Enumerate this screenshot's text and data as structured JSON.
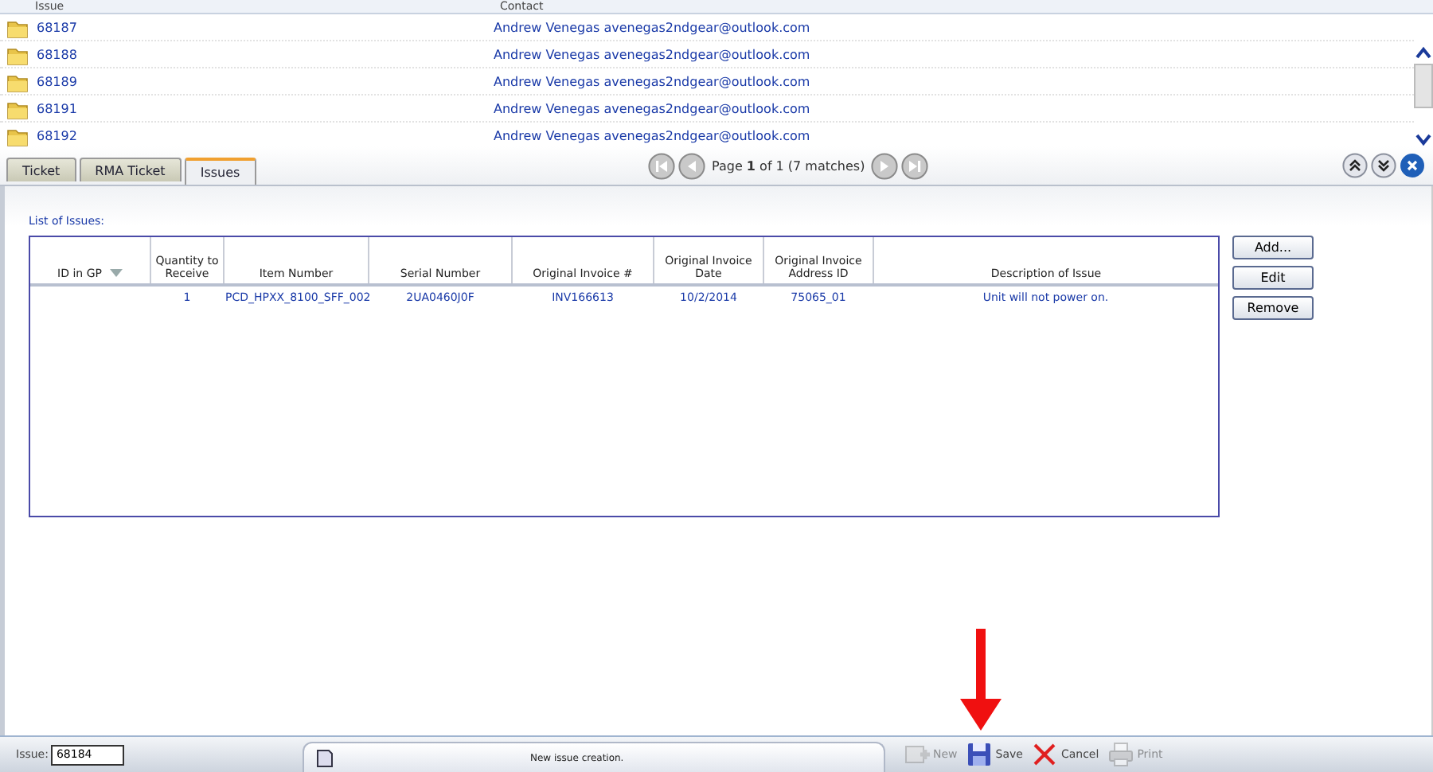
{
  "issue_list": {
    "columns": [
      "Issue",
      "Contact"
    ],
    "rows": [
      {
        "issue": "68187",
        "contact": "Andrew Venegas avenegas2ndgear@outlook.com"
      },
      {
        "issue": "68188",
        "contact": "Andrew Venegas avenegas2ndgear@outlook.com"
      },
      {
        "issue": "68189",
        "contact": "Andrew Venegas avenegas2ndgear@outlook.com"
      },
      {
        "issue": "68191",
        "contact": "Andrew Venegas avenegas2ndgear@outlook.com"
      },
      {
        "issue": "68192",
        "contact": "Andrew Venegas avenegas2ndgear@outlook.com"
      }
    ]
  },
  "tabs": [
    {
      "label": "Ticket",
      "selected": false
    },
    {
      "label": "RMA Ticket",
      "selected": false
    },
    {
      "label": "Issues",
      "selected": true
    }
  ],
  "pager": {
    "text": "Page **1** of 1 (7 matches)"
  },
  "issues_panel": {
    "title": "List of Issues:",
    "columns": [
      "ID in GP",
      "Quantity to Receive",
      "Item Number",
      "Serial Number",
      "Original Invoice #",
      "Original Invoice Date",
      "Original Invoice Address ID",
      "Description of Issue"
    ],
    "rows": [
      [
        "",
        "1",
        "PCD_HPXX_8100_SFF_002",
        "2UA0460J0F",
        "INV166613",
        "10/2/2014",
        "75065_01",
        "Unit will not power on."
      ]
    ],
    "buttons": [
      "Add...",
      "Edit",
      "Remove"
    ]
  },
  "status_bar": {
    "issue_label": "Issue:",
    "issue_value": "68184",
    "message": "New issue creation.",
    "actions": [
      {
        "kind": "new",
        "label": "New",
        "disabled": true
      },
      {
        "kind": "save",
        "label": "Save",
        "disabled": false
      },
      {
        "kind": "cancel",
        "label": "Cancel",
        "disabled": false
      },
      {
        "kind": "print",
        "label": "Print",
        "disabled": true
      }
    ]
  }
}
